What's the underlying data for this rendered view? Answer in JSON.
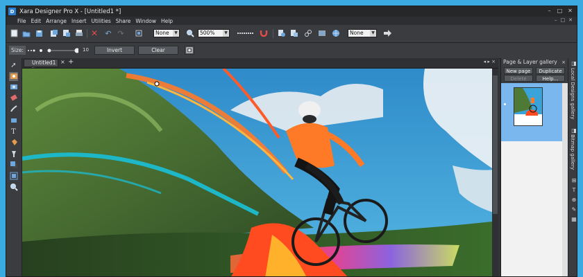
{
  "window": {
    "title": "Xara Designer Pro X - [Untitled1 *]",
    "app_icon": "D",
    "controls": [
      "–",
      "□",
      "✕"
    ],
    "mdi_controls": [
      "–",
      "□",
      "✕"
    ]
  },
  "menu": [
    "File",
    "Edit",
    "Arrange",
    "Insert",
    "Utilities",
    "Share",
    "Window",
    "Help"
  ],
  "toolbar": {
    "quality_value": "None",
    "zoom_value": "500%",
    "feather_value": "None"
  },
  "toolbar2": {
    "size_label": "Size:",
    "size_value": "10",
    "invert_label": "Invert",
    "clear_label": "Clear"
  },
  "document": {
    "tab_label": "Untitled1 *",
    "tab_close": "×",
    "tab_add": "+",
    "tab_nav": "◂ ▸ ×"
  },
  "gallery": {
    "title": "Page & Layer gallery",
    "close": "×",
    "new_page": "New page",
    "duplicate": "Duplicate",
    "delete": "Delete",
    "help": "Help..."
  },
  "side_tabs": {
    "local_designs": "Local Designs gallery",
    "bitmap": "Bitmap gallery"
  },
  "colors": {
    "desktop": "#3aaae0",
    "chrome": "#3a3c3f",
    "gallery_selected": "#79b7ee"
  }
}
